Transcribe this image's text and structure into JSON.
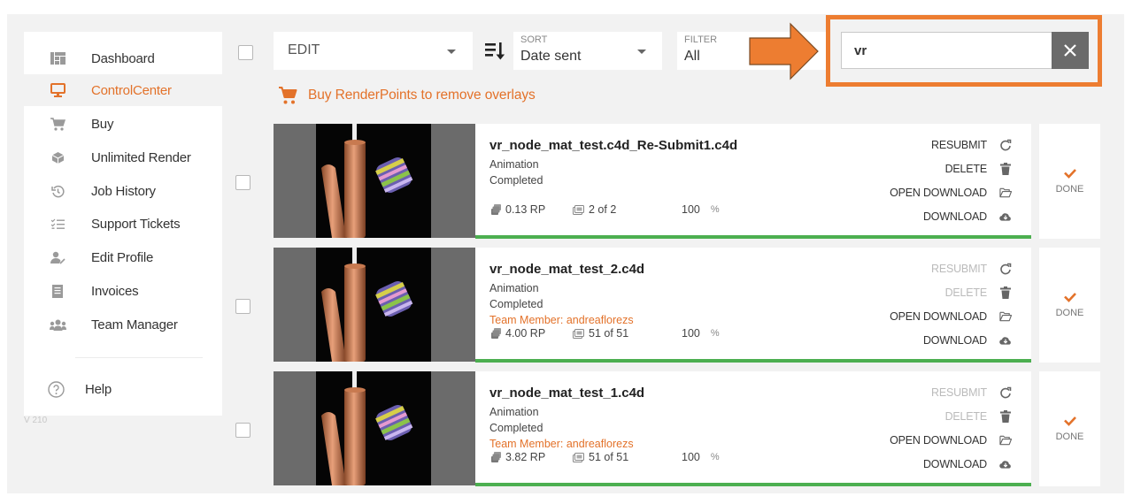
{
  "sidebar": {
    "items": [
      {
        "label": "Dashboard",
        "icon": "dashboard-icon",
        "active": false
      },
      {
        "label": "ControlCenter",
        "icon": "monitor-icon",
        "active": true
      },
      {
        "label": "Buy",
        "icon": "cart-icon",
        "active": false
      },
      {
        "label": "Unlimited Render",
        "icon": "cube-icon",
        "active": false
      },
      {
        "label": "Job History",
        "icon": "history-icon",
        "active": false
      },
      {
        "label": "Support Tickets",
        "icon": "checklist-icon",
        "active": false
      },
      {
        "label": "Edit Profile",
        "icon": "user-edit-icon",
        "active": false
      },
      {
        "label": "Invoices",
        "icon": "invoice-icon",
        "active": false
      },
      {
        "label": "Team Manager",
        "icon": "team-icon",
        "active": false
      }
    ],
    "help": {
      "label": "Help",
      "icon": "help-circle-icon"
    },
    "version": "V 210"
  },
  "toolbar": {
    "edit": {
      "value": "EDIT"
    },
    "sort": {
      "label": "SORT",
      "value": "Date sent"
    },
    "filter": {
      "label": "FILTER",
      "value": "All"
    },
    "search": {
      "value": "vr",
      "placeholder": ""
    },
    "buy_link": "Buy RenderPoints to remove overlays"
  },
  "colors": {
    "accent": "#e3722a",
    "highlight": "#ed7d31",
    "progress": "#4caf50"
  },
  "jobs": [
    {
      "name": "vr_node_mat_test.c4d_Re-Submit1.c4d",
      "type": "Animation",
      "status": "Completed",
      "team_member": "",
      "rp": "0.13 RP",
      "frames": "2 of 2",
      "progress": "100",
      "progress_symbol": "%",
      "actions": [
        {
          "label": "RESUBMIT",
          "icon": "redo-icon",
          "enabled": true
        },
        {
          "label": "DELETE",
          "icon": "trash-icon",
          "enabled": true
        },
        {
          "label": "OPEN DOWNLOAD",
          "icon": "folder-open-icon",
          "enabled": true
        },
        {
          "label": "DOWNLOAD",
          "icon": "cloud-download-icon",
          "enabled": true
        }
      ],
      "done_label": "DONE"
    },
    {
      "name": "vr_node_mat_test_2.c4d",
      "type": "Animation",
      "status": "Completed",
      "team_member": "Team Member: andreaflorezs",
      "rp": "4.00 RP",
      "frames": "51 of 51",
      "progress": "100",
      "progress_symbol": "%",
      "actions": [
        {
          "label": "RESUBMIT",
          "icon": "redo-icon",
          "enabled": false
        },
        {
          "label": "DELETE",
          "icon": "trash-icon",
          "enabled": false
        },
        {
          "label": "OPEN DOWNLOAD",
          "icon": "folder-open-icon",
          "enabled": true
        },
        {
          "label": "DOWNLOAD",
          "icon": "cloud-download-icon",
          "enabled": true
        }
      ],
      "done_label": "DONE"
    },
    {
      "name": "vr_node_mat_test_1.c4d",
      "type": "Animation",
      "status": "Completed",
      "team_member": "Team Member: andreaflorezs",
      "rp": "3.82 RP",
      "frames": "51 of 51",
      "progress": "100",
      "progress_symbol": "%",
      "actions": [
        {
          "label": "RESUBMIT",
          "icon": "redo-icon",
          "enabled": false
        },
        {
          "label": "DELETE",
          "icon": "trash-icon",
          "enabled": false
        },
        {
          "label": "OPEN DOWNLOAD",
          "icon": "folder-open-icon",
          "enabled": true
        },
        {
          "label": "DOWNLOAD",
          "icon": "cloud-download-icon",
          "enabled": true
        }
      ],
      "done_label": "DONE"
    }
  ]
}
